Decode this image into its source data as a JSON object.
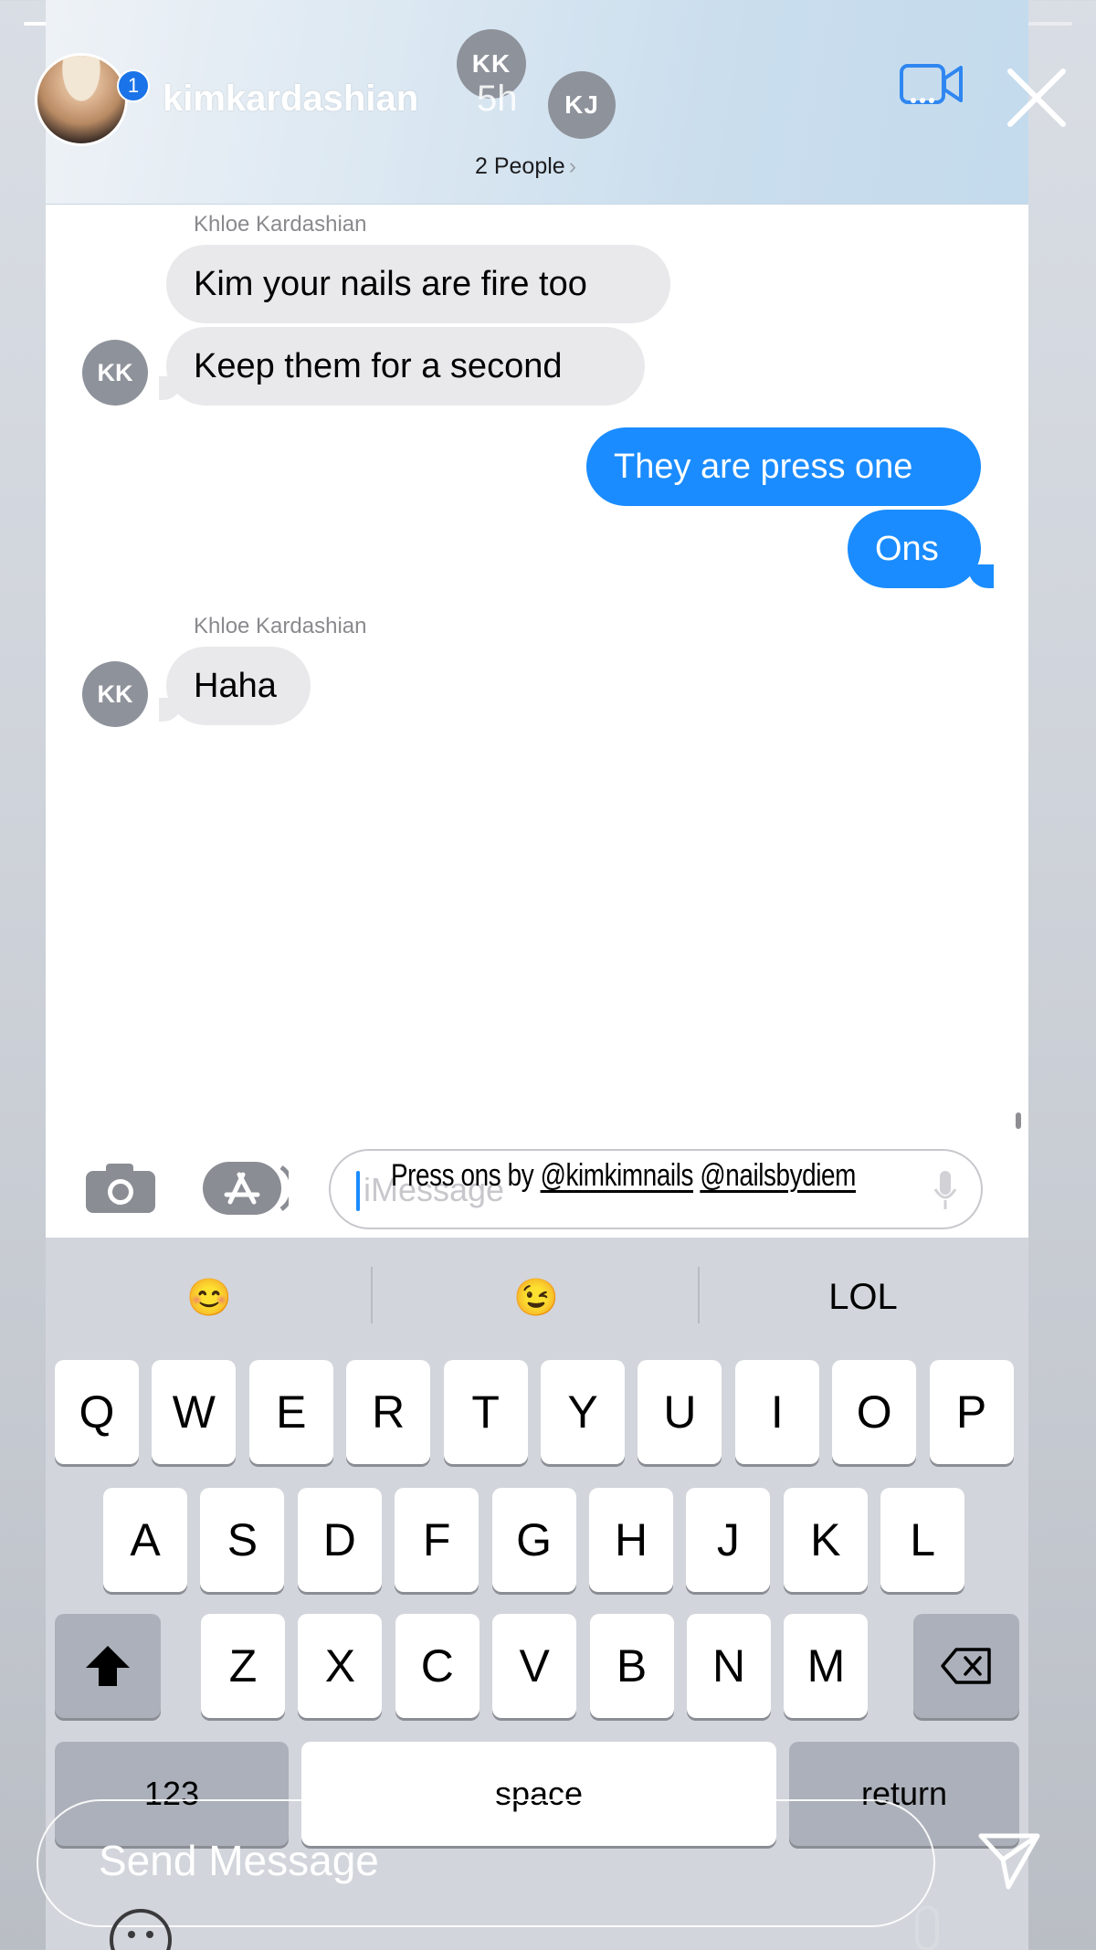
{
  "story": {
    "progress_segments": [
      1,
      1,
      1,
      0.68,
      0
    ],
    "username": "kimkardashian",
    "time": "5h",
    "notification_count": "1",
    "send_placeholder": "Send Message"
  },
  "imessage": {
    "group_avatars": [
      "KK",
      "KJ"
    ],
    "people_label": "2 People",
    "people_chevron": "›",
    "messages": [
      {
        "direction": "in",
        "sender": "Khloe Kardashian",
        "avatar": "",
        "text": "Kim your nails are fire too"
      },
      {
        "direction": "in",
        "sender": "",
        "avatar": "KK",
        "text": "Keep them for a second"
      },
      {
        "direction": "out",
        "text": "They are press one"
      },
      {
        "direction": "out",
        "text": "Ons"
      },
      {
        "direction": "in",
        "sender": "Khloe Kardashian",
        "avatar": "KK",
        "text": "Haha"
      }
    ],
    "input_placeholder": "iMessage"
  },
  "caption": {
    "prefix": "Press ons by ",
    "tag1": "@kimkimnails",
    "tag2": "@nailsbydiem"
  },
  "keyboard": {
    "predictions": [
      "😊",
      "😉",
      "LOL"
    ],
    "row1": [
      "Q",
      "W",
      "E",
      "R",
      "T",
      "Y",
      "U",
      "I",
      "O",
      "P"
    ],
    "row2": [
      "A",
      "S",
      "D",
      "F",
      "G",
      "H",
      "J",
      "K",
      "L"
    ],
    "row3": [
      "Z",
      "X",
      "C",
      "V",
      "B",
      "N",
      "M"
    ],
    "numbers_label": "123",
    "space_label": "space",
    "return_label": "return"
  },
  "colors": {
    "imessage_blue": "#1a8cff",
    "incoming_bubble": "#e9e9eb",
    "avatar_gray": "#8e929a"
  }
}
